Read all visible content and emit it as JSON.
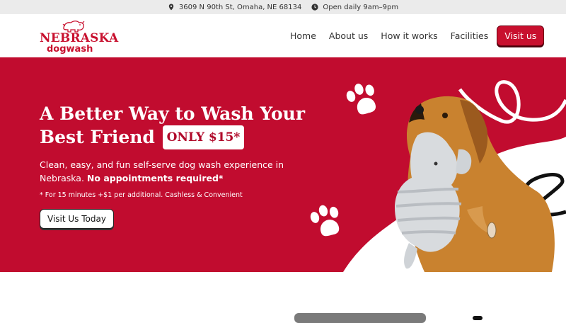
{
  "topbar": {
    "address": "3609 N 90th St, Omaha, NE 68134",
    "hours": "Open daily 9am–9pm",
    "address_icon": "location-pin-icon",
    "hours_icon": "clock-icon"
  },
  "brand": {
    "line1": "NEBRASKA",
    "line2": "dogwash",
    "color": "#c8102e"
  },
  "nav": {
    "items": [
      "Home",
      "About us",
      "How it works",
      "Facilities"
    ],
    "cta": "Visit us"
  },
  "hero": {
    "title": "A Better Way to Wash Your Best Friend",
    "badge": "ONLY $15*",
    "desc_plain": "Clean, easy, and fun self-serve dog wash experience in Nebraska. ",
    "desc_bold": "No appointments required*",
    "note": "* For 15 minutes +$1 per additional. Cashless & Convenient",
    "button": "Visit Us Today",
    "bg_color": "#c10c2f"
  }
}
